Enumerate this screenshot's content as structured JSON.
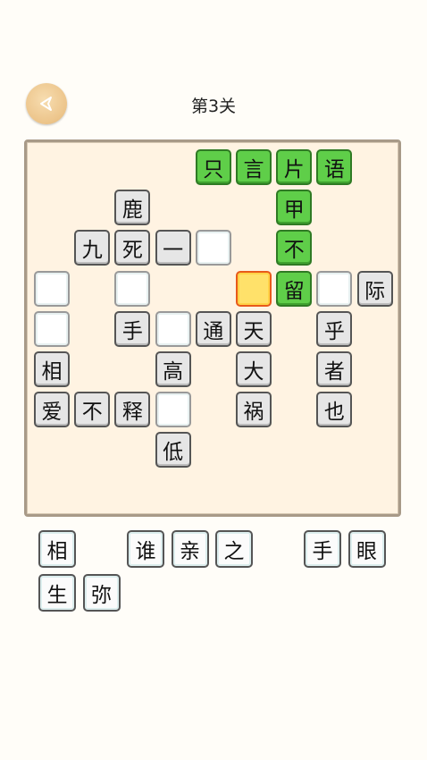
{
  "header": {
    "back_icon": "back-arrow-icon",
    "title": "第3关"
  },
  "colors": {
    "board_bg": "#fff3e2",
    "given_tile": "#e6e6e6",
    "solved_tile": "#5fce49",
    "selected_tile": "#ffe16a",
    "selected_border": "#e85a1a"
  },
  "board": {
    "grid_size": 9,
    "cells": [
      {
        "row": 0,
        "col": 4,
        "char": "只",
        "state": "solved"
      },
      {
        "row": 0,
        "col": 5,
        "char": "言",
        "state": "solved"
      },
      {
        "row": 0,
        "col": 6,
        "char": "片",
        "state": "solved"
      },
      {
        "row": 0,
        "col": 7,
        "char": "语",
        "state": "solved"
      },
      {
        "row": 1,
        "col": 2,
        "char": "鹿",
        "state": "given"
      },
      {
        "row": 1,
        "col": 6,
        "char": "甲",
        "state": "solved"
      },
      {
        "row": 2,
        "col": 1,
        "char": "九",
        "state": "given"
      },
      {
        "row": 2,
        "col": 2,
        "char": "死",
        "state": "given"
      },
      {
        "row": 2,
        "col": 3,
        "char": "一",
        "state": "given"
      },
      {
        "row": 2,
        "col": 4,
        "char": "",
        "state": "empty"
      },
      {
        "row": 2,
        "col": 6,
        "char": "不",
        "state": "solved"
      },
      {
        "row": 3,
        "col": 0,
        "char": "",
        "state": "empty"
      },
      {
        "row": 3,
        "col": 2,
        "char": "",
        "state": "empty"
      },
      {
        "row": 3,
        "col": 5,
        "char": "",
        "state": "selected"
      },
      {
        "row": 3,
        "col": 6,
        "char": "留",
        "state": "solved"
      },
      {
        "row": 3,
        "col": 7,
        "char": "",
        "state": "empty"
      },
      {
        "row": 3,
        "col": 8,
        "char": "际",
        "state": "given"
      },
      {
        "row": 4,
        "col": 0,
        "char": "",
        "state": "empty"
      },
      {
        "row": 4,
        "col": 2,
        "char": "手",
        "state": "given"
      },
      {
        "row": 4,
        "col": 3,
        "char": "",
        "state": "empty"
      },
      {
        "row": 4,
        "col": 4,
        "char": "通",
        "state": "given"
      },
      {
        "row": 4,
        "col": 5,
        "char": "天",
        "state": "given"
      },
      {
        "row": 4,
        "col": 7,
        "char": "乎",
        "state": "given"
      },
      {
        "row": 5,
        "col": 0,
        "char": "相",
        "state": "given"
      },
      {
        "row": 5,
        "col": 3,
        "char": "高",
        "state": "given"
      },
      {
        "row": 5,
        "col": 5,
        "char": "大",
        "state": "given"
      },
      {
        "row": 5,
        "col": 7,
        "char": "者",
        "state": "given"
      },
      {
        "row": 6,
        "col": 0,
        "char": "爱",
        "state": "given"
      },
      {
        "row": 6,
        "col": 1,
        "char": "不",
        "state": "given"
      },
      {
        "row": 6,
        "col": 2,
        "char": "释",
        "state": "given"
      },
      {
        "row": 6,
        "col": 3,
        "char": "",
        "state": "empty"
      },
      {
        "row": 6,
        "col": 5,
        "char": "祸",
        "state": "given"
      },
      {
        "row": 6,
        "col": 7,
        "char": "也",
        "state": "given"
      },
      {
        "row": 7,
        "col": 3,
        "char": "低",
        "state": "given"
      }
    ]
  },
  "choices": [
    {
      "slot": 0,
      "row": 0,
      "char": "相"
    },
    {
      "slot": 2,
      "row": 0,
      "char": "谁"
    },
    {
      "slot": 3,
      "row": 0,
      "char": "亲"
    },
    {
      "slot": 4,
      "row": 0,
      "char": "之"
    },
    {
      "slot": 6,
      "row": 0,
      "char": "手"
    },
    {
      "slot": 7,
      "row": 0,
      "char": "眼"
    },
    {
      "slot": 0,
      "row": 1,
      "char": "生"
    },
    {
      "slot": 1,
      "row": 1,
      "char": "弥"
    }
  ]
}
